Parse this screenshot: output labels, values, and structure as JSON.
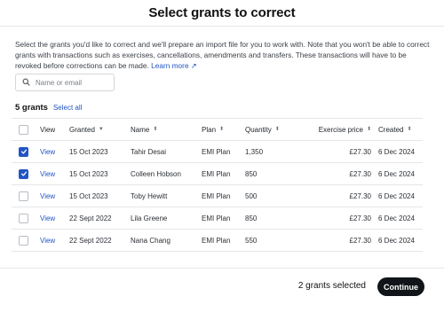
{
  "modal": {
    "title": "Select grants to correct",
    "description": "Select the grants you'd like to correct and we'll prepare an import file for you to work with. Note that you won't be able to correct grants with transactions such as exercises, cancellations, amendments and transfers. These transactions will have to be revoked before corrections can be made.",
    "learn_more": "Learn more ↗"
  },
  "search": {
    "placeholder": "Name or email",
    "value": ""
  },
  "summary": {
    "count_label": "5 grants",
    "select_all": "Select all"
  },
  "table": {
    "headers": {
      "view": "View",
      "granted": "Granted",
      "name": "Name",
      "plan": "Plan",
      "quantity": "Quantity",
      "exercise_price": "Exercise price",
      "created": "Created"
    },
    "rows": [
      {
        "checked": true,
        "view": "View",
        "granted": "15 Oct 2023",
        "name": "Tahir Desai",
        "plan": "EMI Plan",
        "quantity": "1,350",
        "exercise_price": "£27.30",
        "created": "6 Dec 2024"
      },
      {
        "checked": true,
        "view": "View",
        "granted": "15 Oct 2023",
        "name": "Colleen Hobson",
        "plan": "EMI Plan",
        "quantity": "850",
        "exercise_price": "£27.30",
        "created": "6 Dec 2024"
      },
      {
        "checked": false,
        "view": "View",
        "granted": "15 Oct 2023",
        "name": "Toby Hewitt",
        "plan": "EMI Plan",
        "quantity": "500",
        "exercise_price": "£27.30",
        "created": "6 Dec 2024"
      },
      {
        "checked": false,
        "view": "View",
        "granted": "22 Sept 2022",
        "name": "Lila Greene",
        "plan": "EMI Plan",
        "quantity": "850",
        "exercise_price": "£27.30",
        "created": "6 Dec 2024"
      },
      {
        "checked": false,
        "view": "View",
        "granted": "22 Sept 2022",
        "name": "Nana Chang",
        "plan": "EMI Plan",
        "quantity": "550",
        "exercise_price": "£27.30",
        "created": "6 Dec 2024"
      }
    ]
  },
  "footer": {
    "selected_label": "2 grants selected",
    "continue_label": "Continue"
  },
  "icons": {
    "search": "search-icon",
    "sort": "sort-icon",
    "sort_desc": "sort-desc-icon",
    "check": "check-icon",
    "external": "external-link-icon"
  },
  "colors": {
    "accent": "#2255c4",
    "primary_button": "#111418"
  }
}
